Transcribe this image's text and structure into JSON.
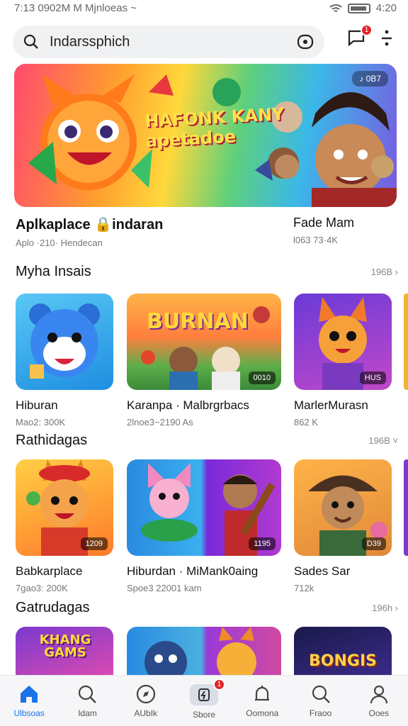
{
  "status": {
    "left": "7:13 0902M M Mjnloeas ~",
    "time": "4:20"
  },
  "search": {
    "text": "Indarssphich"
  },
  "header": {
    "notif_count": "1"
  },
  "banner": {
    "title_line1": "HAFONK KANY",
    "title_line2": "apetadoe",
    "pill": "♪ 0B7"
  },
  "featured": {
    "left_name": "Aplkaplace 🔒indaran",
    "left_sub": "Aplo ·210· Hendecan",
    "right_name": "Fade Mam",
    "right_sub": "l063 73·4K"
  },
  "sections": [
    {
      "title": "Myha Insais",
      "more": "196B ›",
      "items": [
        {
          "name": "Hiburan",
          "sub": "Mao2: 300K",
          "tag": ""
        },
        {
          "name": "Karanpa · Malbrgrbacs",
          "sub": "2lnoe3~2190 As",
          "tag": "0010",
          "title_art": "BURNAN"
        },
        {
          "name": "MarlerMurasn",
          "sub": "862 K",
          "tag": "HUS"
        }
      ]
    },
    {
      "title": "Rathidagas",
      "more": "196B ˅",
      "items": [
        {
          "name": "Babkarplace",
          "sub": "7gao3: 200K",
          "tag": "1209"
        },
        {
          "name": "Hiburdan · MiMank0aing",
          "sub": "Spoe3 22001 kam",
          "tag": "1195"
        },
        {
          "name": "Sades Sar",
          "sub": "712k",
          "tag": "D39"
        }
      ]
    },
    {
      "title": "Gatrudagas",
      "more": "196h ›",
      "items": [
        {
          "name": "",
          "sub": "",
          "tag": "",
          "title_art": "KHANG GAMS"
        },
        {
          "name": "",
          "sub": "",
          "tag": ""
        },
        {
          "name": "",
          "sub": "",
          "tag": "",
          "title_art": "BONGIS"
        }
      ]
    }
  ],
  "nav": [
    {
      "label": "Ulbsoas",
      "icon": "home-icon"
    },
    {
      "label": "Idam",
      "icon": "search-icon"
    },
    {
      "label": "AUbIk",
      "icon": "compass-icon"
    },
    {
      "label": "Sbore",
      "icon": "store-icon",
      "badge": "1"
    },
    {
      "label": "Oomona",
      "icon": "bell-icon"
    },
    {
      "label": "Fraoo",
      "icon": "search-icon"
    },
    {
      "label": "Ooes",
      "icon": "person-icon"
    }
  ]
}
